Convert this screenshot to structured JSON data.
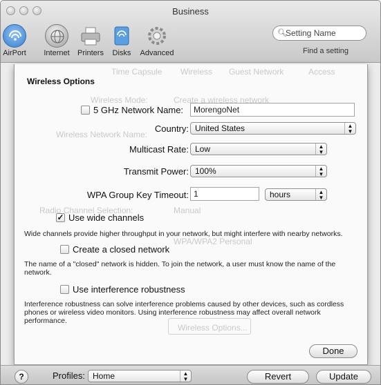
{
  "window": {
    "title": "Business"
  },
  "toolbar": {
    "items": [
      {
        "label": "AirPort",
        "icon": "airport-icon"
      },
      {
        "label": "Internet",
        "icon": "internet-icon"
      },
      {
        "label": "Printers",
        "icon": "printer-icon"
      },
      {
        "label": "Disks",
        "icon": "disk-icon"
      },
      {
        "label": "Advanced",
        "icon": "gear-icon"
      }
    ],
    "search": {
      "placeholder": "Setting Name",
      "caption": "Find a setting"
    }
  },
  "background": {
    "tabs": [
      "Time Capsule",
      "Wireless",
      "Guest Network",
      "Access"
    ],
    "ghost_labels": [
      "Wireless Mode:",
      "Wireless Network Name:",
      "Radio Channel Selection:"
    ],
    "ghost_values": [
      "Create a wireless network",
      "Manual",
      "WPA/WPA2 Personal",
      "Wireless Options..."
    ]
  },
  "sheet": {
    "title": "Wireless Options",
    "network_name": {
      "label": "5 GHz Network Name:",
      "value": "MorengoNet",
      "checked": false
    },
    "country": {
      "label": "Country:",
      "value": "United States"
    },
    "multicast": {
      "label": "Multicast Rate:",
      "value": "Low"
    },
    "transmit": {
      "label": "Transmit Power:",
      "value": "100%"
    },
    "wpa": {
      "label": "WPA Group Key Timeout:",
      "value": "1",
      "unit": "hours"
    },
    "wide_channels": {
      "label": "Use wide channels",
      "checked": true,
      "help": "Wide channels provide higher throughput in your network, but might interfere with nearby networks."
    },
    "closed_network": {
      "label": "Create a closed network",
      "checked": false,
      "help": "The name of a \"closed\" network is hidden. To join the network, a user must know the name of the network."
    },
    "interference": {
      "label": "Use interference robustness",
      "checked": false,
      "help": "Interference robustness can solve interference problems caused by other devices, such as cordless phones or wireless video monitors. Using interference robustness may affect overall network performance."
    },
    "done_label": "Done"
  },
  "bottom": {
    "help_label": "?",
    "profiles_label": "Profiles:",
    "profiles_value": "Home",
    "revert_label": "Revert",
    "update_label": "Update"
  },
  "colors": {
    "airport_blue": "#4a8fd6",
    "window_bg": "#ececec"
  }
}
